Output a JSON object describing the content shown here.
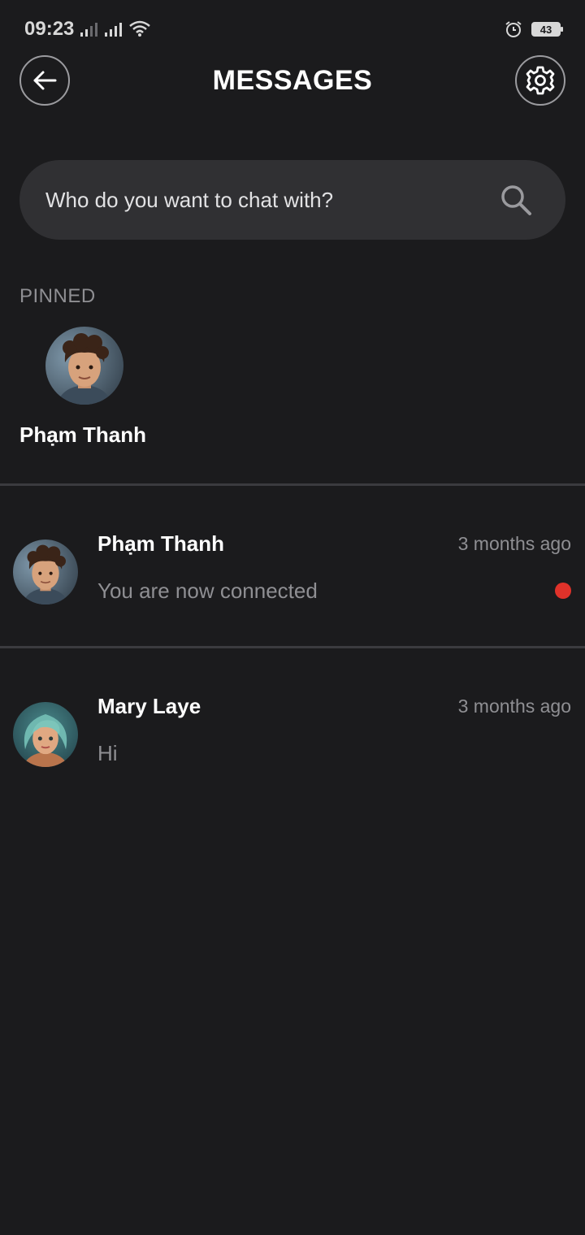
{
  "status_bar": {
    "time": "09:23",
    "battery": "43",
    "icons": [
      "signal-icon",
      "signal-icon",
      "wifi-icon",
      "alarm-icon",
      "battery-icon"
    ]
  },
  "header": {
    "title": "MESSAGES",
    "back_icon": "arrow-left-icon",
    "settings_icon": "gear-icon"
  },
  "search": {
    "placeholder": "Who do you want to chat with?",
    "value": "",
    "icon": "search-icon"
  },
  "pinned": {
    "label": "PINNED",
    "items": [
      {
        "name": "Phạm Thanh"
      }
    ]
  },
  "conversations": [
    {
      "name": "Phạm Thanh",
      "time": "3 months ago",
      "preview": "You are now connected",
      "unread": true
    },
    {
      "name": "Mary Laye",
      "time": "3 months ago",
      "preview": "Hi",
      "unread": false
    }
  ],
  "colors": {
    "background": "#1b1b1d",
    "search_bg": "#303033",
    "muted_text": "#8f8f93",
    "unread_dot": "#e0322a"
  }
}
